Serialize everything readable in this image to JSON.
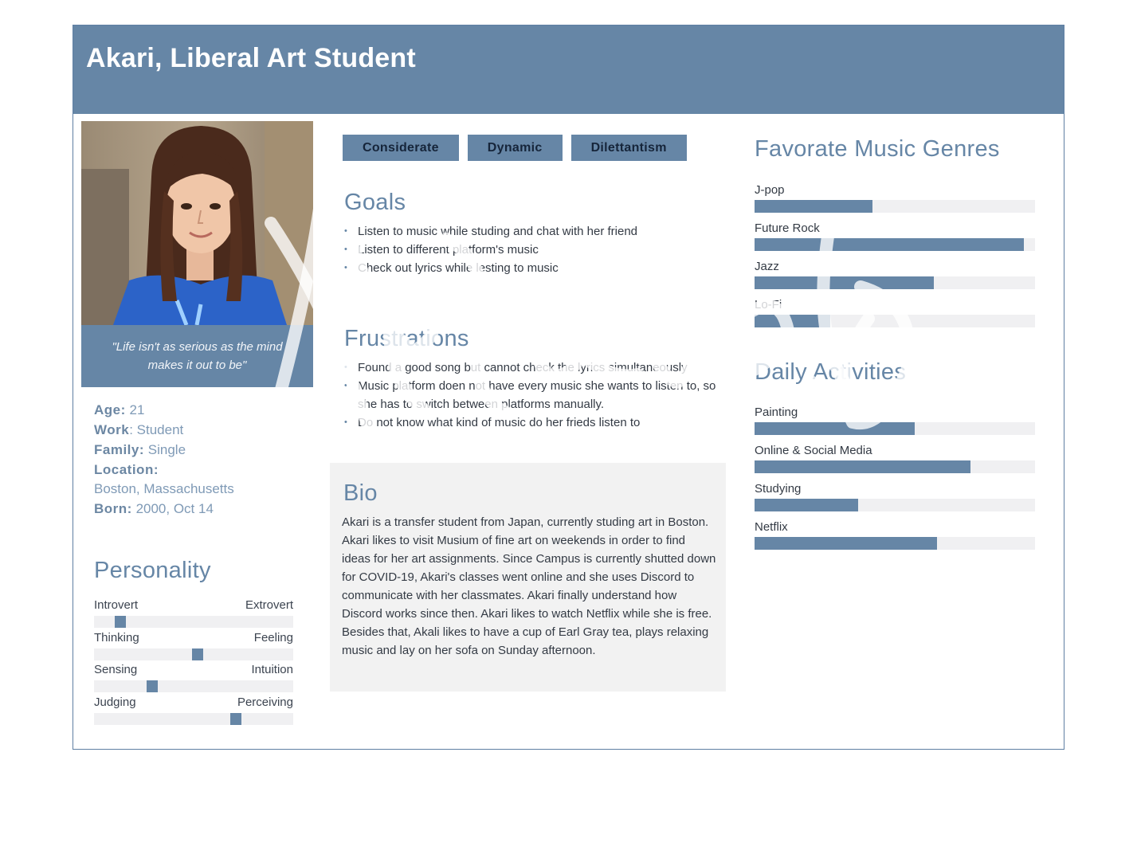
{
  "persona": {
    "title": "Akari, Liberal Art Student",
    "quote": "\"Life isn't as serious as the mind makes it out to be\"",
    "photo_icon": "portrait-photo",
    "info": {
      "age_label": "Age:",
      "age_value": "21",
      "work_label": "Work",
      "work_value": ": Student",
      "family_label": "Family:",
      "family_value": "Single",
      "location_label": "Location:",
      "location_value": "Boston, Massachusetts",
      "born_label": "Born:",
      "born_value": "2000, Oct 14"
    }
  },
  "personality": {
    "title": "Personality",
    "scales": [
      {
        "left": "Introvert",
        "right": "Extrovert",
        "value": 0.13
      },
      {
        "left": "Thinking",
        "right": "Feeling",
        "value": 0.52
      },
      {
        "left": "Sensing",
        "right": "Intuition",
        "value": 0.29
      },
      {
        "left": "Judging",
        "right": "Perceiving",
        "value": 0.71
      }
    ]
  },
  "tags": [
    "Considerate",
    "Dynamic",
    "Dilettantism"
  ],
  "goals": {
    "title": "Goals",
    "items": [
      "Listen to music while studing and chat with her friend",
      "Listen to different platform's music",
      "Check out lyrics while lesting to music"
    ]
  },
  "frustrations": {
    "title": "Frustrations",
    "items": [
      "Found a good song but cannot check the lyrics simultaneously",
      "Music platform doen not have every music she wants to listen to, so she has to switch between platforms manually.",
      "Do not know what kind of music do her frieds listen to"
    ]
  },
  "bio": {
    "title": "Bio",
    "text": "Akari is a transfer student from Japan, currently studing art in Boston. Akari likes to visit Musium of fine art on weekends in order to find ideas for her art assignments. Since Campus is currently shutted down for COVID-19, Akari's classes went online and she uses Discord to communicate with her classmates. Akari finally understand how Discord works since then. Akari likes to watch Netflix while she is free. Besides that, Akali likes to have a cup of Earl Gray tea, plays relaxing music and lay on her sofa on Sunday afternoon."
  },
  "genres": {
    "title": "Favorate Music Genres",
    "items": [
      {
        "label": "J-pop",
        "value": 0.42
      },
      {
        "label": "Future Rock",
        "value": 0.96
      },
      {
        "label": "Jazz",
        "value": 0.64
      },
      {
        "label": "Lo-Fi",
        "value": 0.27
      }
    ]
  },
  "activities": {
    "title": "Daily Activities",
    "items": [
      {
        "label": "Painting",
        "value": 0.57
      },
      {
        "label": "Online & Social Media",
        "value": 0.77
      },
      {
        "label": "Studying",
        "value": 0.37
      },
      {
        "label": "Netflix",
        "value": 0.65
      }
    ]
  },
  "colors": {
    "accent": "#6686a6",
    "track": "#f0f0f2",
    "bio_bg": "#f2f2f2"
  }
}
